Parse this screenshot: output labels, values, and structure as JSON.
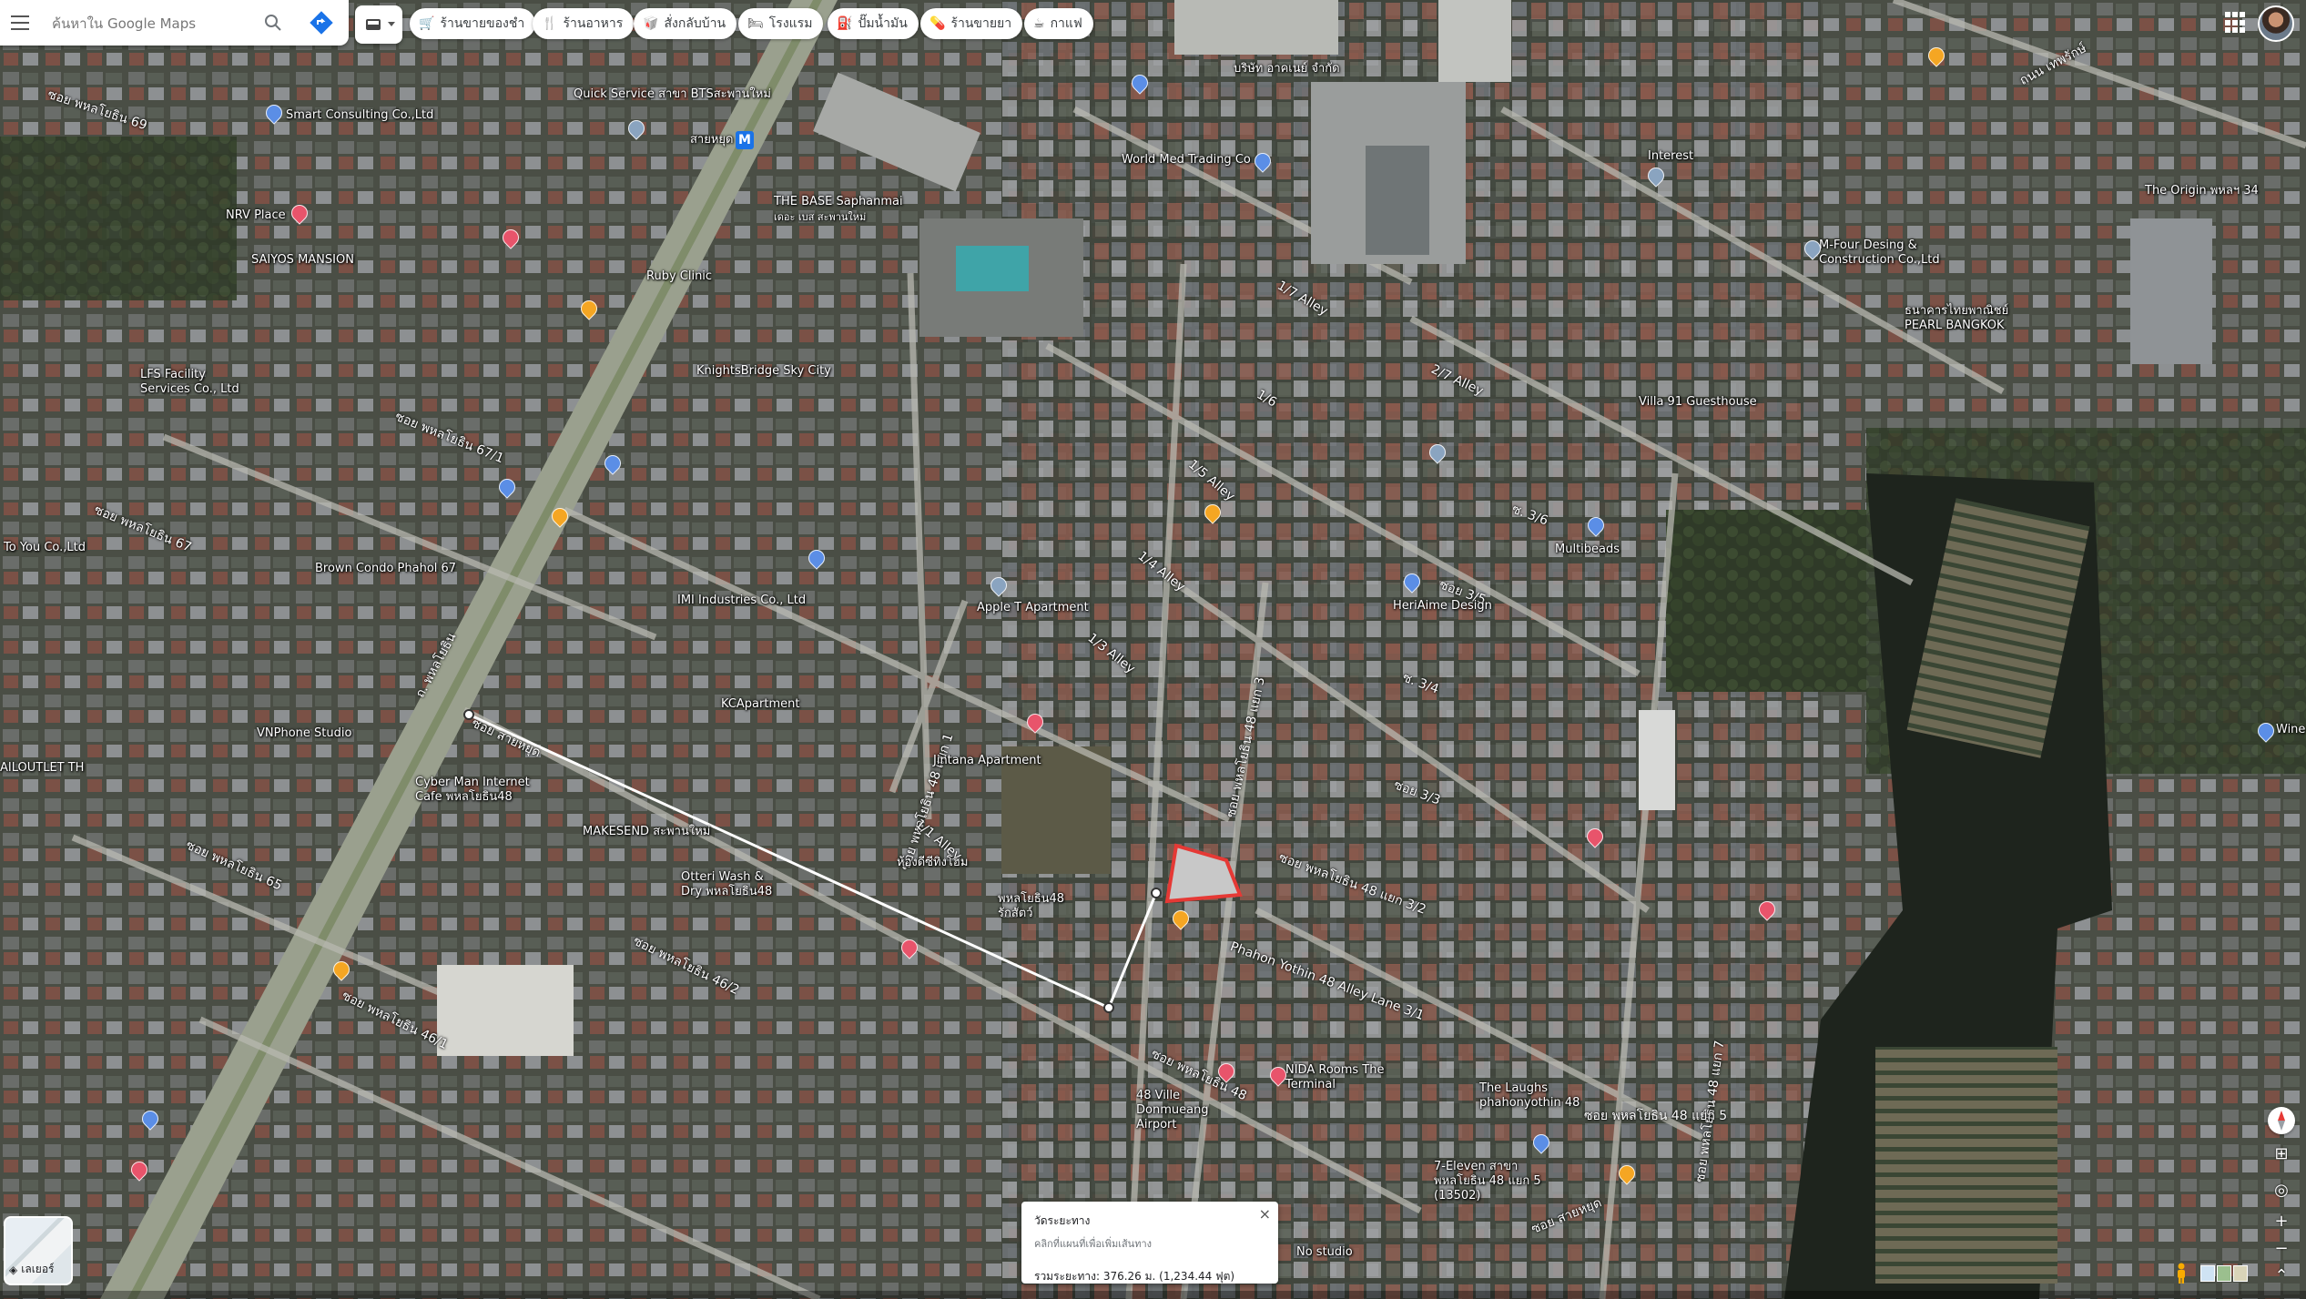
{
  "search": {
    "placeholder": "ค้นหาใน Google Maps"
  },
  "categories": [
    {
      "label": "ร้านขายของชำ",
      "icon": "cart-icon"
    },
    {
      "label": "ร้านอาหาร",
      "icon": "fork-knife-icon"
    },
    {
      "label": "สั่งกลับบ้าน",
      "icon": "takeout-icon"
    },
    {
      "label": "โรงแรม",
      "icon": "bed-icon"
    },
    {
      "label": "ปั๊มน้ำมัน",
      "icon": "gas-pump-icon"
    },
    {
      "label": "ร้านขายยา",
      "icon": "pharmacy-icon"
    },
    {
      "label": "กาแฟ",
      "icon": "coffee-icon"
    }
  ],
  "colors": {
    "road": "#c9c9c9",
    "highlight": "#e53935",
    "accent": "#1a73e8"
  },
  "places": [
    {
      "name": "Smart Consulting Co.,Ltd",
      "pin": "blue"
    },
    {
      "name": "Quick Service สาขา BTSสะพานใหม่",
      "pin": "gray"
    },
    {
      "name": "บริษัท อาคเนย์ จำกัด",
      "pin": "gray"
    },
    {
      "name": "World Med Trading Co",
      "pin": "gray"
    },
    {
      "name": "THE BASE Saphanmai",
      "pin": "gray"
    },
    {
      "name": "เดอะ เบส สะพานใหม่",
      "pin": "none"
    },
    {
      "name": "NRV Place",
      "pin": "red"
    },
    {
      "name": "SAIYOS MANSION",
      "pin": "red"
    },
    {
      "name": "Ruby Clinic",
      "pin": "gray"
    },
    {
      "name": "KnightsBridge Sky City",
      "pin": "gray"
    },
    {
      "name": "LFS Facility Services Co., Ltd",
      "pin": "gray"
    },
    {
      "name": "Brown Condo Phahol 67",
      "pin": "gray"
    },
    {
      "name": "IMI Industries Co., Ltd",
      "pin": "gray"
    },
    {
      "name": "Apple T Apartment",
      "pin": "gray"
    },
    {
      "name": "KCApartment",
      "pin": "gray"
    },
    {
      "name": "Jintana Apartment",
      "pin": "gray"
    },
    {
      "name": "Cyber Man Internet Cafe พหลโยธิน48",
      "pin": "blue"
    },
    {
      "name": "MAKESEND สะพานใหม่",
      "pin": "gray"
    },
    {
      "name": "Otteri Wash & Dry พหลโยธิน48",
      "pin": "gray"
    },
    {
      "name": "พหลโยธิน48 รักสัตว์",
      "pin": "orange"
    },
    {
      "name": "ห้องดีซีทิงโฮม",
      "pin": "orange"
    },
    {
      "name": "Interest",
      "pin": "gray"
    },
    {
      "name": "The Origin พหลฯ 34",
      "pin": "gray"
    },
    {
      "name": "M-Four Desing & Construction Co.,Ltd",
      "pin": "gray"
    },
    {
      "name": "ธนาคารไทยพาณิชย์ PEARL BANGKOK",
      "pin": "blue"
    },
    {
      "name": "Villa 91 Guesthouse",
      "pin": "red"
    },
    {
      "name": "Multibeads",
      "pin": "blue"
    },
    {
      "name": "HeriAime Design",
      "pin": "blue"
    },
    {
      "name": "NIDA Rooms The Terminal",
      "pin": "red"
    },
    {
      "name": "48 Ville Donmueang Airport",
      "pin": "red"
    },
    {
      "name": "The Laughs phahonyothin 48",
      "pin": "gray"
    },
    {
      "name": "7-Eleven สาขา พหลโยธิน 48 แยก 5 (13502)",
      "pin": "blue"
    },
    {
      "name": "No studio",
      "pin": "gray"
    },
    {
      "name": "To You Co.,Ltd",
      "pin": "none"
    },
    {
      "name": "VNPhone Studio",
      "pin": "blue"
    },
    {
      "name": "AILOUTLET TH",
      "pin": "blue"
    },
    {
      "name": "Wine",
      "pin": "blue"
    }
  ],
  "roads": [
    {
      "name": "ซอย พหลโยธิน 69"
    },
    {
      "name": "ซอย พหลโยธิน 67/1"
    },
    {
      "name": "ซอย พหลโยธิน 67"
    },
    {
      "name": "ซอย พหลโยธิน 65"
    },
    {
      "name": "ถ. พหลโยธิน"
    },
    {
      "name": "ซอย สายหยุด"
    },
    {
      "name": "ซอย พหลโยธิน 48 แยก 1"
    },
    {
      "name": "ซอย พหลโยธิน 48 แยก 3"
    },
    {
      "name": "ซอย พหลโยธิน 48 แยก 3/2"
    },
    {
      "name": "Phahon Yothin 48 Alley Lane 3/1"
    },
    {
      "name": "ซอย พหลโยธิน 48"
    },
    {
      "name": "ซอย พหลโยธิน 46/2"
    },
    {
      "name": "ซอย พหลโยธิน 46/1"
    },
    {
      "name": "1/7 Alley"
    },
    {
      "name": "1/6"
    },
    {
      "name": "1/5 Alley"
    },
    {
      "name": "1/4 Alley"
    },
    {
      "name": "1/3 Alley"
    },
    {
      "name": "1/1 Alley"
    },
    {
      "name": "2/7 Alley"
    },
    {
      "name": "ซ. 3/6"
    },
    {
      "name": "ซอย 3/5"
    },
    {
      "name": "ซ. 3/4"
    },
    {
      "name": "ซอย 3/3"
    },
    {
      "name": "ถนน เทพรักษ์"
    },
    {
      "name": "ซอย พหลโยธิน 48 แยก 7"
    },
    {
      "name": "ซอย พหลโยธิน 48 แยก 5"
    },
    {
      "name": "ซอย สายหยุด"
    }
  ],
  "station": {
    "name": "สายหยุด",
    "badge": "M"
  },
  "measure": {
    "title": "วัดระยะทาง",
    "subtitle": "คลิกที่แผนที่เพื่อเพิ่มเส้นทาง",
    "distance": "รวมระยะทาง: 376.26 ม. (1,234.44 ฟุต)",
    "close": "×"
  },
  "layers": {
    "label": "เลเยอร์"
  }
}
